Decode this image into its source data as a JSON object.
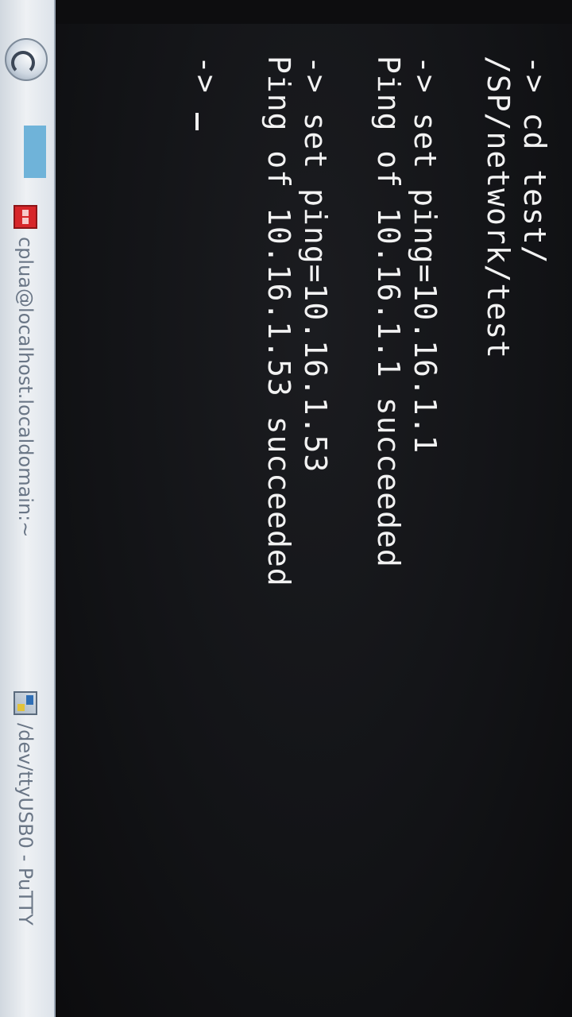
{
  "terminal": {
    "lines": [
      "-> cd test/",
      "/SP/network/test",
      "",
      "-> set ping=10.16.1.1",
      "Ping of 10.16.1.1 succeeded",
      "",
      "-> set ping=10.16.1.53",
      "Ping of 10.16.1.53 succeeded",
      "",
      "->"
    ]
  },
  "taskbar": {
    "start_icon": "start-orb-icon",
    "items": [
      {
        "label": "cplua@localhost.localdomain:~",
        "icon": "terminal-app-icon"
      },
      {
        "label": "/dev/ttyUSB0 - PuTTY",
        "icon": "putty-icon"
      }
    ]
  },
  "colors": {
    "terminal_bg": "#121316",
    "terminal_text": "#f2f2f2",
    "taskbar_bg": "#e4e9ee",
    "taskbar_text": "#6a7686"
  }
}
